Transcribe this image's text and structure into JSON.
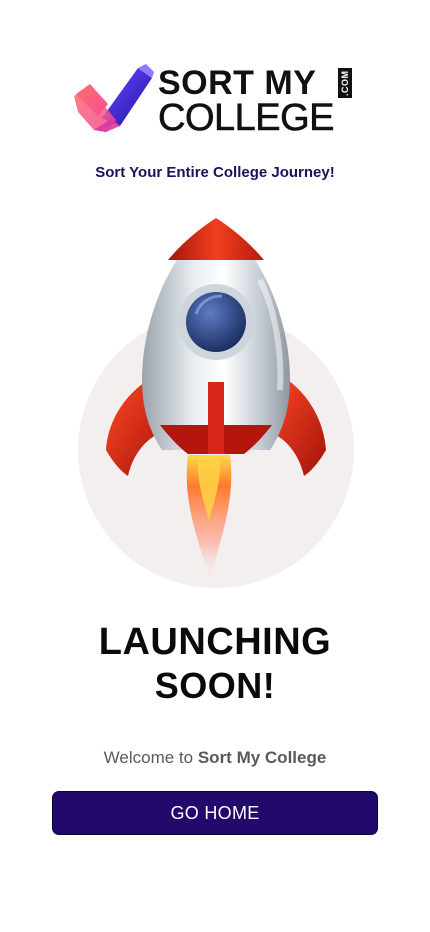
{
  "brand": {
    "name_line1": "SORT MY",
    "name_line2": "COLLEGE",
    "domain_suffix": ".COM",
    "colors": {
      "navy": "#22096b",
      "pink": "#f35a8c",
      "blue": "#3b2ad9"
    }
  },
  "tagline": "Sort Your Entire College Journey!",
  "illustration": {
    "icon": "rocket-icon"
  },
  "headline": {
    "line1": "LAUNCHING",
    "line2": "SOON!"
  },
  "welcome": {
    "prefix": "Welcome to ",
    "brand": "Sort My College"
  },
  "cta": {
    "label": "GO HOME"
  }
}
